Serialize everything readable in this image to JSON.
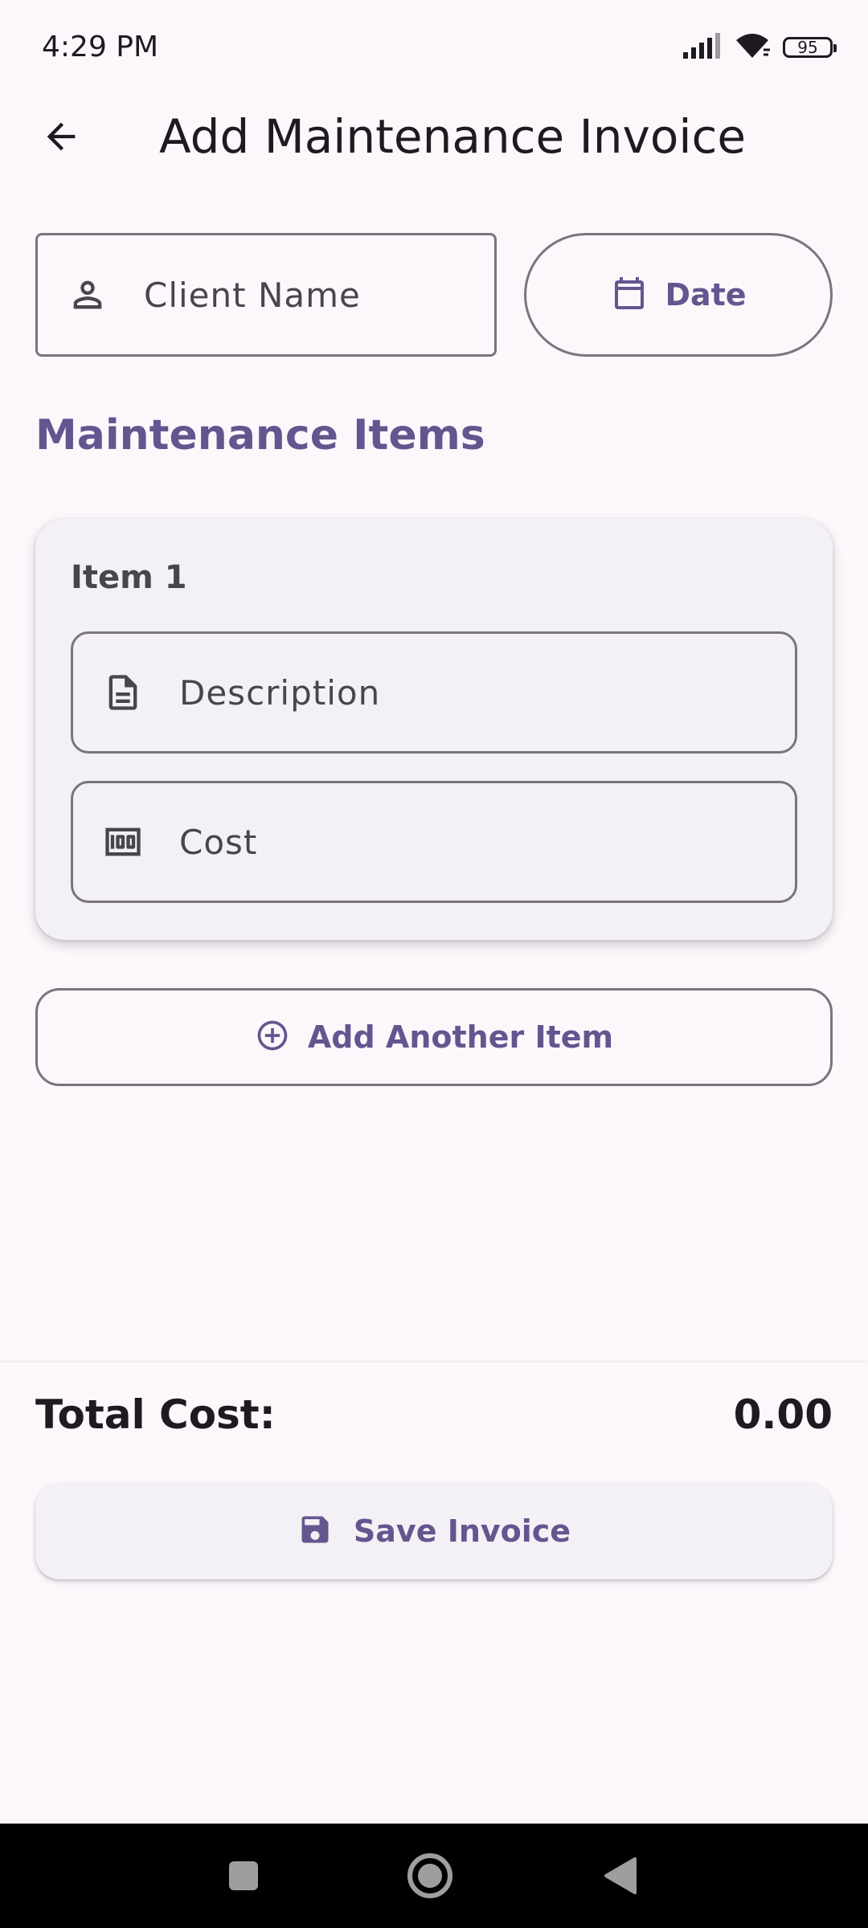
{
  "status_bar": {
    "time": "4:29 PM",
    "battery_level": "95",
    "signal_icon": "signal-icon",
    "wifi_icon": "wifi-icon"
  },
  "app_bar": {
    "title": "Add Maintenance Invoice",
    "back_icon": "arrow-back-icon"
  },
  "form": {
    "client_name_placeholder": "Client Name",
    "date_label": "Date",
    "section_title": "Maintenance Items",
    "items": [
      {
        "title": "Item 1",
        "description_placeholder": "Description",
        "cost_placeholder": "Cost"
      }
    ],
    "add_item_label": "Add Another Item"
  },
  "summary": {
    "total_label": "Total Cost:",
    "total_value": "0.00",
    "save_label": "Save Invoice"
  },
  "colors": {
    "primary": "#65558F",
    "background": "#FDF7FC",
    "surface": "#F3F1F5",
    "outline": "#79747E",
    "on_surface": "#1D1B20",
    "on_surface_variant": "#49454F"
  }
}
